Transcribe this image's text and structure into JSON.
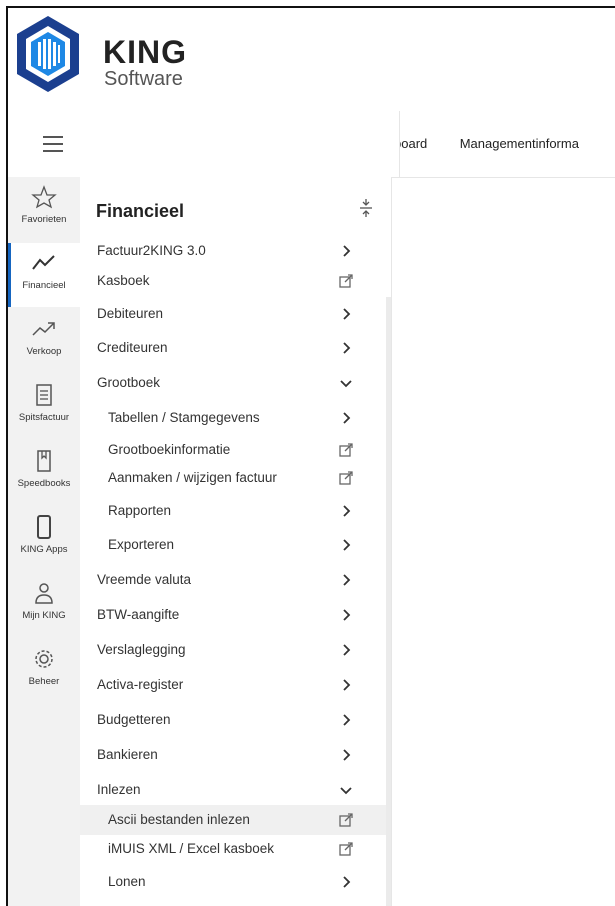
{
  "brand": {
    "name": "KING",
    "tagline": "Software"
  },
  "tabs": [
    {
      "label": "board"
    },
    {
      "label": "Managementinforma"
    }
  ],
  "rail": [
    {
      "label": "Favorieten",
      "icon": "star-icon"
    },
    {
      "label": "Financieel",
      "icon": "line-chart-icon",
      "active": true
    },
    {
      "label": "Verkoop",
      "icon": "trend-up-icon"
    },
    {
      "label": "Spitsfactuur",
      "icon": "document-icon"
    },
    {
      "label": "Speedbooks",
      "icon": "book-icon"
    },
    {
      "label": "KING Apps",
      "icon": "phone-icon"
    },
    {
      "label": "Mijn KING",
      "icon": "user-icon"
    },
    {
      "label": "Beheer",
      "icon": "gear-icon"
    }
  ],
  "menu": {
    "title": "Financieel",
    "items": [
      {
        "label": "Factuur2KING 3.0",
        "indicator": "chevron-right"
      },
      {
        "label": "Kasboek",
        "indicator": "external-link"
      },
      {
        "label": "Debiteuren",
        "indicator": "chevron-right"
      },
      {
        "label": "Crediteuren",
        "indicator": "chevron-right"
      },
      {
        "label": "Grootboek",
        "indicator": "chevron-down"
      },
      {
        "label": "Tabellen / Stamgegevens",
        "indicator": "chevron-right",
        "sub": true
      },
      {
        "label": "Grootboekinformatie",
        "indicator": "external-link",
        "sub": true
      },
      {
        "label": "Aanmaken / wijzigen factuur",
        "indicator": "external-link",
        "sub": true
      },
      {
        "label": "Rapporten",
        "indicator": "chevron-right",
        "sub": true
      },
      {
        "label": "Exporteren",
        "indicator": "chevron-right",
        "sub": true
      },
      {
        "label": "Vreemde valuta",
        "indicator": "chevron-right"
      },
      {
        "label": "BTW-aangifte",
        "indicator": "chevron-right"
      },
      {
        "label": "Verslaglegging",
        "indicator": "chevron-right"
      },
      {
        "label": "Activa-register",
        "indicator": "chevron-right"
      },
      {
        "label": "Budgetteren",
        "indicator": "chevron-right"
      },
      {
        "label": "Bankieren",
        "indicator": "chevron-right"
      },
      {
        "label": "Inlezen",
        "indicator": "chevron-down"
      },
      {
        "label": "Ascii bestanden inlezen",
        "indicator": "external-link",
        "sub": true,
        "highlight": true
      },
      {
        "label": "iMUIS XML / Excel kasboek",
        "indicator": "external-link",
        "sub": true
      },
      {
        "label": "Lonen",
        "indicator": "chevron-right",
        "sub": true
      }
    ]
  }
}
